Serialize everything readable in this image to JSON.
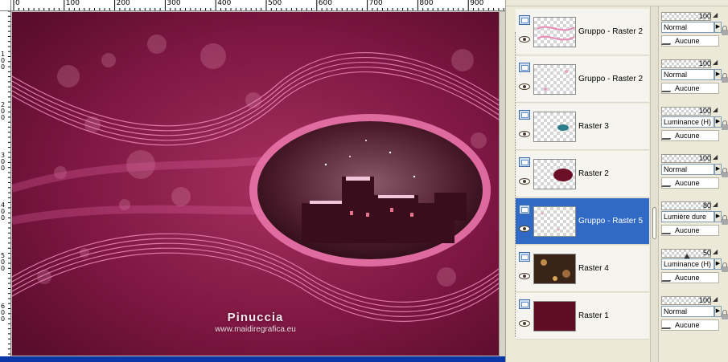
{
  "rulers": {
    "top_labels": [
      "0",
      "100",
      "200",
      "300",
      "400",
      "500",
      "600",
      "700",
      "800",
      "900"
    ],
    "left_labels": [
      "1 0 0",
      "2 0 0",
      "3 0 0",
      "4 0 0",
      "5 0 0",
      "6 0 0"
    ]
  },
  "canvas": {
    "watermark_title": "Pinuccia",
    "watermark_url": "www.maidiregrafica.eu"
  },
  "layers": [
    {
      "name": "Gruppo - Raster 2",
      "opacity": "100",
      "blend_mode": "Normal",
      "mask": "Aucune",
      "selected": false
    },
    {
      "name": "Gruppo - Raster 2",
      "opacity": "100",
      "blend_mode": "Normal",
      "mask": "Aucune",
      "selected": false
    },
    {
      "name": "Raster 3",
      "opacity": "100",
      "blend_mode": "Luminance (H)",
      "mask": "Aucune",
      "selected": false
    },
    {
      "name": "Raster 2",
      "opacity": "100",
      "blend_mode": "Normal",
      "mask": "Aucune",
      "selected": false
    },
    {
      "name": "Gruppo - Raster 5",
      "opacity": "80",
      "blend_mode": "Lumière dure",
      "mask": "Aucune",
      "selected": true
    },
    {
      "name": "Raster 4",
      "opacity": "50",
      "blend_mode": "Luminance (H)",
      "mask": "Aucune",
      "selected": false
    },
    {
      "name": "Raster 1",
      "opacity": "100",
      "blend_mode": "Normal",
      "mask": "Aucune",
      "selected": false
    }
  ],
  "icons": {
    "visibility": "layer-visibility-icon",
    "eye": "eye-icon",
    "mask": "brush-icon",
    "lock": "lock-icon"
  },
  "colors": {
    "canvas_base": "#7a1440",
    "selection": "#316ac5",
    "raster1_fill": "#5e0d24"
  }
}
